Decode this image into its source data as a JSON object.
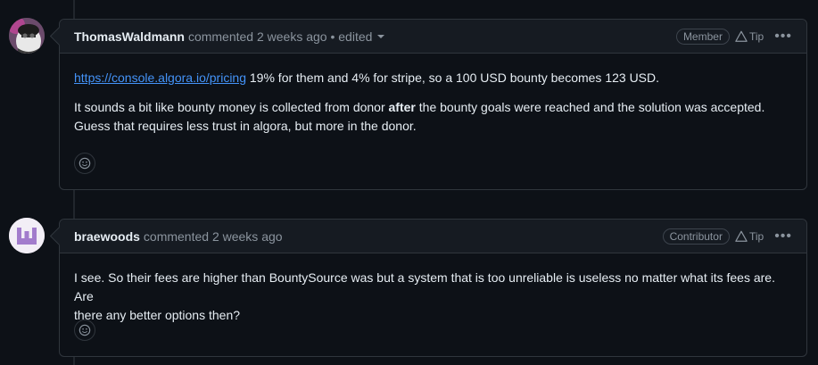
{
  "comments": [
    {
      "author": "ThomasWaldmann",
      "meta": "commented 2 weeks ago • edited",
      "role": "Member",
      "tip": "Tip",
      "more": "•••",
      "link": "https://console.algora.io/pricing",
      "line1_rest": " 19% for them and 4% for stripe, so a 100 USD bounty becomes 123 USD.",
      "line2_pre": "It sounds a bit like bounty money is collected from donor ",
      "line2_bold": "after",
      "line2_post": " the bounty goals were reached and the solution was accepted.",
      "line3": "Guess that requires less trust in algora, but more in the donor."
    },
    {
      "author": "braewoods",
      "meta": "commented 2 weeks ago",
      "role": "Contributor",
      "tip": "Tip",
      "more": "•••",
      "line1": "I see. So their fees are higher than BountySource was but a system that is too unreliable is useless no matter what its fees are. Are",
      "line2": "there any better options then?"
    }
  ],
  "icons": {
    "tip": "alert-triangle-icon",
    "reaction": "smiley-icon",
    "menu": "kebab-horizontal-icon"
  }
}
